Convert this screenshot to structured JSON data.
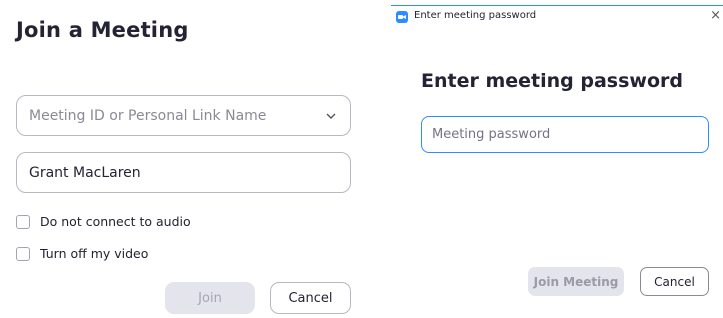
{
  "join_dialog": {
    "title": "Join a Meeting",
    "meeting_id_placeholder": "Meeting ID or Personal Link Name",
    "name_value": "Grant MacLaren",
    "options": {
      "audio_label": "Do not connect to audio",
      "video_label": "Turn off my video"
    },
    "join_label": "Join",
    "cancel_label": "Cancel"
  },
  "password_dialog": {
    "window_title": "Enter meeting password",
    "heading": "Enter meeting password",
    "password_placeholder": "Meeting password",
    "join_label": "Join Meeting",
    "cancel_label": "Cancel",
    "close_glyph": "×"
  },
  "colors": {
    "accent": "#2d8cff",
    "disabled_bg": "#e4e4ec",
    "text": "#232333"
  },
  "icons": {
    "dropdown": "chevron-down-icon",
    "app": "zoom-app-icon",
    "close": "close-icon"
  }
}
